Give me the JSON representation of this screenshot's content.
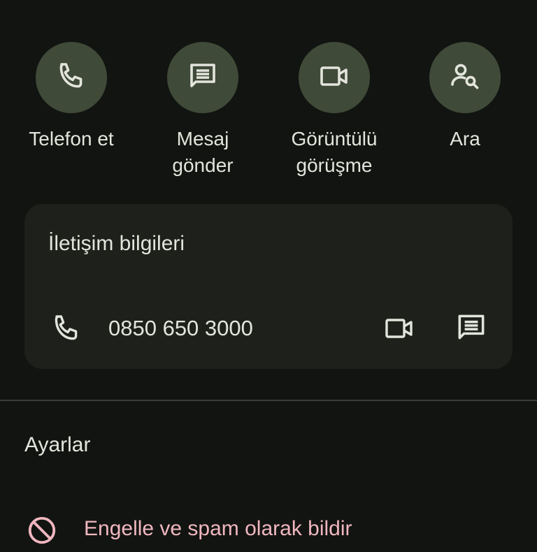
{
  "actions": [
    {
      "label_line1": "Telefon et",
      "label_line2": "",
      "icon": "phone-icon"
    },
    {
      "label_line1": "Mesaj",
      "label_line2": "gönder",
      "icon": "message-icon"
    },
    {
      "label_line1": "Görüntülü",
      "label_line2": "görüşme",
      "icon": "video-icon"
    },
    {
      "label_line1": "Ara",
      "label_line2": "",
      "icon": "search-person-icon"
    }
  ],
  "contact_card": {
    "title": "İletişim bilgileri",
    "phone_number": "0850 650 3000"
  },
  "settings": {
    "title": "Ayarlar",
    "block_label": "Engelle ve spam olarak bildir"
  },
  "colors": {
    "background": "#121411",
    "action_circle": "#3f4a38",
    "card": "#1d201b",
    "warning_text": "#f0b7bf"
  }
}
